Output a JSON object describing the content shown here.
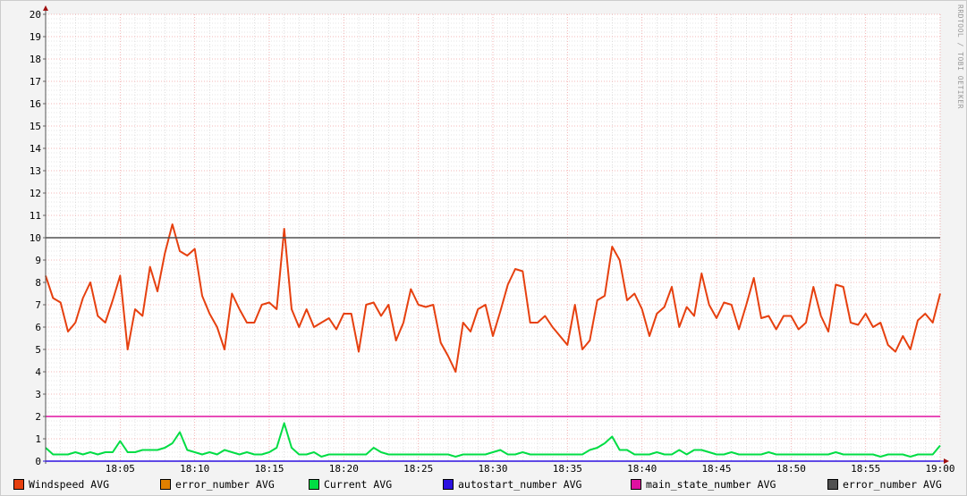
{
  "watermark": "RRDTOOL / TOBI OETIKER",
  "chart_data": {
    "type": "line",
    "title": "",
    "xlabel": "",
    "ylabel": "",
    "ylim": [
      0,
      20
    ],
    "xlim_minutes_after_18_00": [
      0,
      60
    ],
    "yticks": [
      "0",
      "1",
      "2",
      "3",
      "4",
      "5",
      "6",
      "7",
      "8",
      "9",
      "10",
      "11",
      "12",
      "13",
      "14",
      "15",
      "16",
      "17",
      "18",
      "19",
      "20"
    ],
    "xticks": [
      {
        "t": 5,
        "label": "18:05"
      },
      {
        "t": 10,
        "label": "18:10"
      },
      {
        "t": 15,
        "label": "18:15"
      },
      {
        "t": 20,
        "label": "18:20"
      },
      {
        "t": 25,
        "label": "18:25"
      },
      {
        "t": 30,
        "label": "18:30"
      },
      {
        "t": 35,
        "label": "18:35"
      },
      {
        "t": 40,
        "label": "18:40"
      },
      {
        "t": 45,
        "label": "18:45"
      },
      {
        "t": 50,
        "label": "18:50"
      },
      {
        "t": 55,
        "label": "18:55"
      },
      {
        "t": 60,
        "label": "19:00"
      }
    ],
    "grid": true,
    "legend_position": "bottom",
    "x_step_minutes": 0.5,
    "series": [
      {
        "name": "Windspeed AVG",
        "color": "#e6400f",
        "values": [
          8.3,
          7.3,
          7.1,
          5.8,
          6.2,
          7.3,
          8.0,
          6.5,
          6.2,
          7.2,
          8.3,
          5.0,
          6.8,
          6.5,
          8.7,
          7.6,
          9.3,
          10.6,
          9.4,
          9.2,
          9.5,
          7.4,
          6.6,
          6.0,
          5.0,
          7.5,
          6.8,
          6.2,
          6.2,
          7.0,
          7.1,
          6.8,
          10.4,
          6.8,
          6.0,
          6.8,
          6.0,
          6.2,
          6.4,
          5.9,
          6.6,
          6.6,
          4.9,
          7.0,
          7.1,
          6.5,
          7.0,
          5.4,
          6.2,
          7.7,
          7.0,
          6.9,
          7.0,
          5.3,
          4.7,
          4.0,
          6.2,
          5.8,
          6.8,
          7.0,
          5.6,
          6.7,
          7.9,
          8.6,
          8.5,
          6.2,
          6.2,
          6.5,
          6.0,
          5.6,
          5.2,
          7.0,
          5.0,
          5.4,
          7.2,
          7.4,
          9.6,
          9.0,
          7.2,
          7.5,
          6.8,
          5.6,
          6.6,
          6.9,
          7.8,
          6.0,
          6.9,
          6.5,
          8.4,
          7.0,
          6.4,
          7.1,
          7.0,
          5.9,
          7.0,
          8.2,
          6.4,
          6.5,
          5.9,
          6.5,
          6.5,
          5.9,
          6.2,
          7.8,
          6.5,
          5.8,
          7.9,
          7.8,
          6.2,
          6.1,
          6.6,
          6.0,
          6.2,
          5.2,
          4.9,
          5.6,
          5.0,
          6.3,
          6.6,
          6.2,
          7.5
        ]
      },
      {
        "name": "error_number AVG",
        "color": "#e08000",
        "values": []
      },
      {
        "name": "Current AVG",
        "color": "#00dd44",
        "values": [
          0.6,
          0.3,
          0.3,
          0.3,
          0.4,
          0.3,
          0.4,
          0.3,
          0.4,
          0.4,
          0.9,
          0.4,
          0.4,
          0.5,
          0.5,
          0.5,
          0.6,
          0.8,
          1.3,
          0.5,
          0.4,
          0.3,
          0.4,
          0.3,
          0.5,
          0.4,
          0.3,
          0.4,
          0.3,
          0.3,
          0.4,
          0.6,
          1.7,
          0.6,
          0.3,
          0.3,
          0.4,
          0.2,
          0.3,
          0.3,
          0.3,
          0.3,
          0.3,
          0.3,
          0.6,
          0.4,
          0.3,
          0.3,
          0.3,
          0.3,
          0.3,
          0.3,
          0.3,
          0.3,
          0.3,
          0.2,
          0.3,
          0.3,
          0.3,
          0.3,
          0.4,
          0.5,
          0.3,
          0.3,
          0.4,
          0.3,
          0.3,
          0.3,
          0.3,
          0.3,
          0.3,
          0.3,
          0.3,
          0.5,
          0.6,
          0.8,
          1.1,
          0.5,
          0.5,
          0.3,
          0.3,
          0.3,
          0.4,
          0.3,
          0.3,
          0.5,
          0.3,
          0.5,
          0.5,
          0.4,
          0.3,
          0.3,
          0.4,
          0.3,
          0.3,
          0.3,
          0.3,
          0.4,
          0.3,
          0.3,
          0.3,
          0.3,
          0.3,
          0.3,
          0.3,
          0.3,
          0.4,
          0.3,
          0.3,
          0.3,
          0.3,
          0.3,
          0.2,
          0.3,
          0.3,
          0.3,
          0.2,
          0.3,
          0.3,
          0.3,
          0.7
        ]
      },
      {
        "name": "autostart_number AVG",
        "color": "#2c10e0",
        "constant": 0
      },
      {
        "name": "main_state_number AVG",
        "color": "#e010a0",
        "constant": 2
      },
      {
        "name": "error_number AVG",
        "color": "#505050",
        "constant": 10
      }
    ]
  }
}
